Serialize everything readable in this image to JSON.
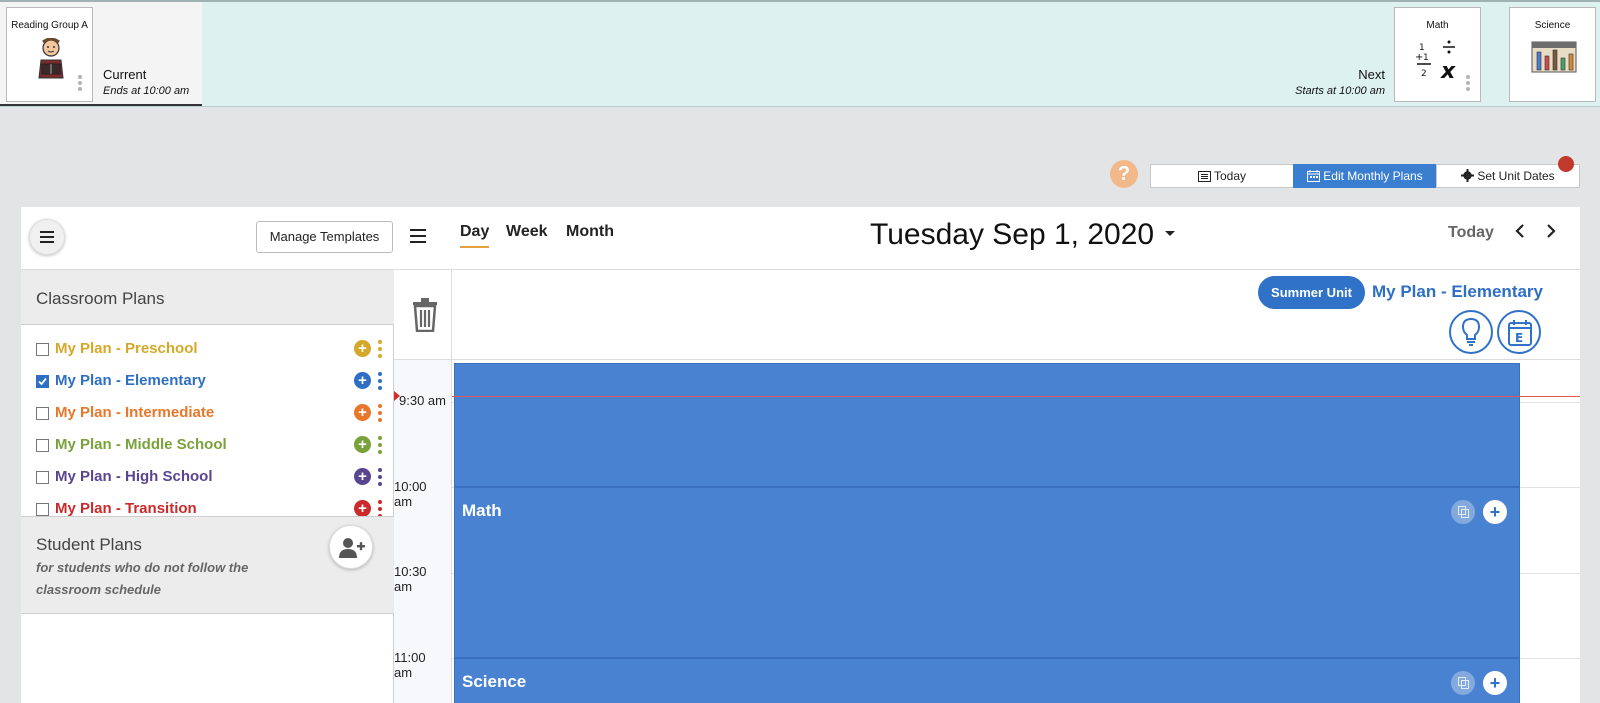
{
  "activity_strip": {
    "current": {
      "card_title": "Reading Group A",
      "label": "Current",
      "sub_label": "Ends at 10:00 am"
    },
    "next": {
      "card_title": "Math",
      "label": "Next",
      "sub_label": "Starts at 10:00 am"
    },
    "after": {
      "card_title": "Science"
    }
  },
  "toolbar": {
    "help_glyph": "?",
    "today_label": "Today",
    "edit_monthly_label": "Edit Monthly Plans",
    "set_unit_dates_label": "Set Unit Dates"
  },
  "header": {
    "manage_templates_label": "Manage Templates",
    "tabs": [
      {
        "label": "Day",
        "active": true
      },
      {
        "label": "Week",
        "active": false
      },
      {
        "label": "Month",
        "active": false
      }
    ],
    "date_title": "Tuesday Sep 1, 2020",
    "today_label": "Today"
  },
  "sidebar": {
    "classroom_plans_title": "Classroom Plans",
    "plans": [
      {
        "name": "My Plan - Preschool",
        "color": "#d4a92a",
        "checked": false
      },
      {
        "name": "My Plan - Elementary",
        "color": "#2f6fc3",
        "checked": true
      },
      {
        "name": "My Plan - Intermediate",
        "color": "#e8772a",
        "checked": false
      },
      {
        "name": "My Plan - Middle School",
        "color": "#79a23a",
        "checked": false
      },
      {
        "name": "My Plan - High School",
        "color": "#5a4590",
        "checked": false
      },
      {
        "name": "My Plan - Transition",
        "color": "#cc2a2a",
        "checked": false
      }
    ],
    "student_plans_title": "Student Plans",
    "student_plans_subtitle": "for students who do not follow the classroom schedule"
  },
  "plan_header": {
    "unit_label": "Summer Unit",
    "plan_name": "My Plan - Elementary",
    "e_glyph": "E"
  },
  "time_labels": [
    "9:30 am",
    "10:00 am",
    "10:30 am",
    "11:00 am"
  ],
  "events": [
    {
      "title": ""
    },
    {
      "title": "Math"
    },
    {
      "title": "Science"
    }
  ],
  "colors": {
    "accent": "#3a7ed0",
    "event": "#4a82d2",
    "strip": "#ddf2f0",
    "now_line": "#e05555"
  }
}
